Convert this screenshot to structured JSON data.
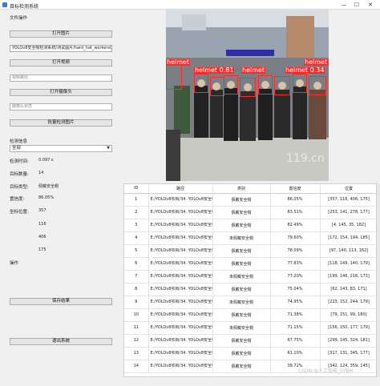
{
  "window": {
    "title": "目标检测系统",
    "min": "—",
    "max": "☐",
    "close": "✕"
  },
  "left": {
    "file_section": "文件操作",
    "open_image": "打开图片",
    "image_path": "YOLOv8安全帽检测系统/测试图片/hard_hat_workers0.png",
    "open_video": "打开视频",
    "video_placeholder": "视频路径",
    "open_camera": "打开摄像头",
    "camera_placeholder": "摄像头状态",
    "batch_detect": "批量检测图片",
    "info_section": "检测信息",
    "filter_value": "全部",
    "time_label": "检测时间:",
    "time_value": "0.097 s",
    "count_label": "目标数量:",
    "count_value": "14",
    "type_label": "目标类型:",
    "type_value": "佩戴安全帽",
    "conf_label": "置信度:",
    "conf_value": "86.05%",
    "pos_label": "坐标位置:",
    "pos_values": [
      "357",
      "116",
      "406",
      "175"
    ],
    "ops_section": "操作",
    "save_button": "保存结果",
    "exit_button": "退出系统"
  },
  "image": {
    "scene": "detection-image",
    "sign_text": "119.cn",
    "labels": [
      "helmet",
      "helmet 0.81",
      "helmet",
      "helmet 0.34",
      "helmet"
    ]
  },
  "table": {
    "headers": [
      "ID",
      "路径",
      "类别",
      "置信度",
      "位置"
    ],
    "path_text": "E:/YOLOv8项目/34. YOLOv8安全帽检测系统/YOLOv8安全帽检测系...",
    "rows": [
      {
        "id": "1",
        "cls": "佩戴安全帽",
        "conf": "86.05%",
        "pos": "[357, 116, 406, 175]"
      },
      {
        "id": "2",
        "cls": "佩戴安全帽",
        "conf": "83.51%",
        "pos": "[253, 141, 278, 177]"
      },
      {
        "id": "3",
        "cls": "佩戴安全帽",
        "conf": "82.49%",
        "pos": "[4, 145, 35, 182]"
      },
      {
        "id": "4",
        "cls": "未佩戴安全帽",
        "conf": "79.60%",
        "pos": "[172, 154, 194, 185]"
      },
      {
        "id": "5",
        "cls": "佩戴安全帽",
        "conf": "78.09%",
        "pos": "[97, 140, 113, 162]"
      },
      {
        "id": "6",
        "cls": "佩戴安全帽",
        "conf": "77.83%",
        "pos": "[118, 149, 140, 179]"
      },
      {
        "id": "7",
        "cls": "未佩戴安全帽",
        "conf": "77.20%",
        "pos": "[199, 146, 216, 173]"
      },
      {
        "id": "8",
        "cls": "佩戴安全帽",
        "conf": "75.04%",
        "pos": "[62, 143, 83, 171]"
      },
      {
        "id": "9",
        "cls": "未佩戴安全帽",
        "conf": "74.95%",
        "pos": "[223, 152, 244, 179]"
      },
      {
        "id": "10",
        "cls": "佩戴安全帽",
        "conf": "71.38%",
        "pos": "[79, 151, 99, 180]"
      },
      {
        "id": "11",
        "cls": "未佩戴安全帽",
        "conf": "71.15%",
        "pos": "[156, 150, 177, 179]"
      },
      {
        "id": "12",
        "cls": "佩戴安全帽",
        "conf": "67.75%",
        "pos": "[299, 145, 324, 181]"
      },
      {
        "id": "13",
        "cls": "佩戴安全帽",
        "conf": "61.10%",
        "pos": "[317, 131, 345, 177]"
      },
      {
        "id": "14",
        "cls": "佩戴安全帽",
        "conf": "39.72%",
        "pos": "[342, 124, 359, 145]"
      }
    ]
  },
  "watermark": "CSDN @人工智能_SYBH"
}
